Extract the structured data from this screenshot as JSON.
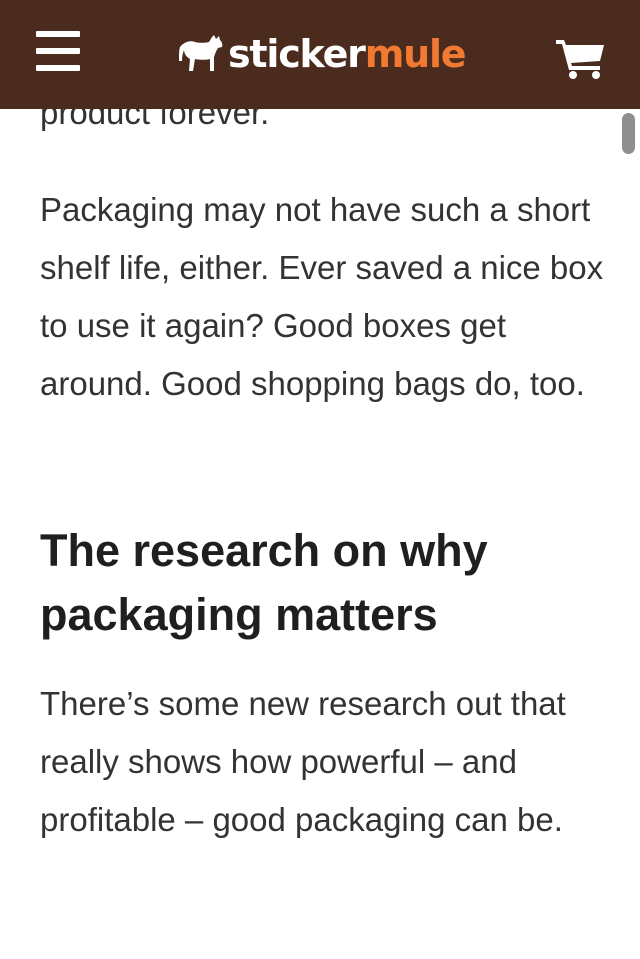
{
  "header": {
    "logo_part1": "sticker",
    "logo_part2": "mule",
    "menu_icon": "hamburger-menu-icon",
    "logo_icon": "mule-icon",
    "cart_icon": "shopping-cart-icon",
    "background_color": "#4a2b1d",
    "logo_accent_color": "#f07a32"
  },
  "article": {
    "cut_off_line": "product forever.",
    "paragraph_1": "Packaging may not have such a short shelf life, either. Ever saved a nice box to use it again? Good boxes get around. Good shopping bags do, too.",
    "heading": "The research on why packaging matters",
    "paragraph_2": "There’s some new research out that really shows how powerful – and profitable – good packaging can be."
  }
}
